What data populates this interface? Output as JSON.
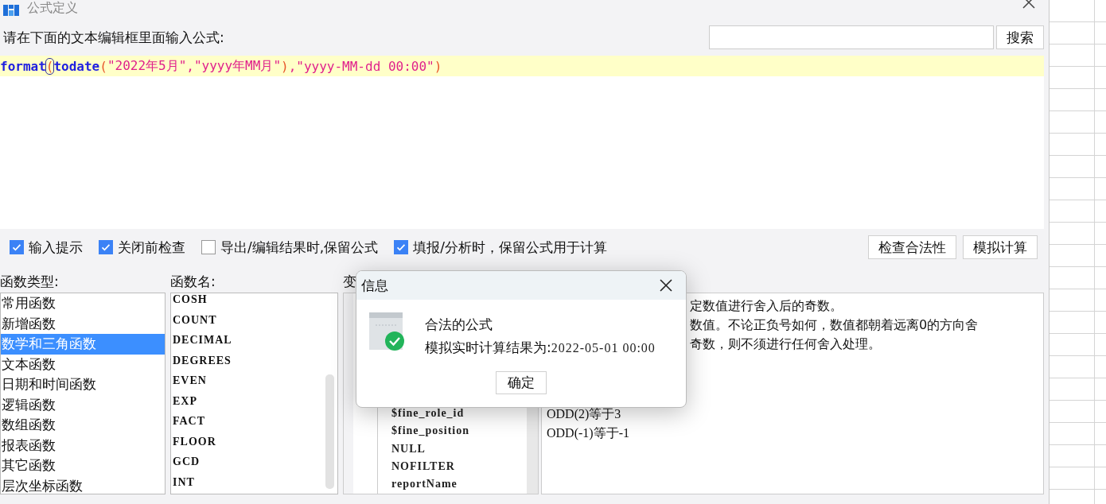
{
  "window": {
    "title": "公式定义"
  },
  "prompt": {
    "label": "请在下面的文本编辑框里面输入公式:",
    "search_button": "搜索"
  },
  "editor": {
    "tokens": [
      {
        "text": "format",
        "kind": "function",
        "boxed": false
      },
      {
        "text": "(",
        "kind": "paren",
        "boxed": true
      },
      {
        "text": "todate",
        "kind": "function",
        "boxed": false
      },
      {
        "text": "(",
        "kind": "paren",
        "boxed": false
      },
      {
        "text": "\"2022年5月\"",
        "kind": "string",
        "boxed": false
      },
      {
        "text": ",",
        "kind": "string",
        "boxed": false
      },
      {
        "text": "\"yyyy年MM月\"",
        "kind": "string",
        "boxed": false
      },
      {
        "text": ")",
        "kind": "paren",
        "boxed": false
      },
      {
        "text": ",",
        "kind": "string",
        "boxed": false
      },
      {
        "text": "\"yyyy-MM-dd 00:00\"",
        "kind": "string",
        "boxed": false
      },
      {
        "text": ")",
        "kind": "paren",
        "boxed": false
      }
    ]
  },
  "options": [
    {
      "label": "输入提示",
      "checked": true
    },
    {
      "label": "关闭前检查",
      "checked": true
    },
    {
      "label": "导出/编辑结果时,保留公式",
      "checked": false
    },
    {
      "label": "填报/分析时，保留公式用于计算",
      "checked": true
    }
  ],
  "action_buttons": [
    "检查合法性",
    "模拟计算"
  ],
  "function_types": {
    "label": "函数类型:",
    "items": [
      {
        "label": "常用函数",
        "selected": false
      },
      {
        "label": "新增函数",
        "selected": false
      },
      {
        "label": "数学和三角函数",
        "selected": true
      },
      {
        "label": "文本函数",
        "selected": false
      },
      {
        "label": "日期和时间函数",
        "selected": false
      },
      {
        "label": "逻辑函数",
        "selected": false
      },
      {
        "label": "数组函数",
        "selected": false
      },
      {
        "label": "报表函数",
        "selected": false
      },
      {
        "label": "其它函数",
        "selected": false
      },
      {
        "label": "层次坐标函数",
        "selected": false
      }
    ]
  },
  "function_names": {
    "label": "函数名:",
    "items": [
      "COSH",
      "COUNT",
      "DECIMAL",
      "DEGREES",
      "EVEN",
      "EXP",
      "FACT",
      "FLOOR",
      "GCD",
      "INT"
    ]
  },
  "variables": {
    "label": "变",
    "items": [
      "$fine_role_id",
      "$fine_position",
      "NULL",
      "NOFILTER",
      "reportName"
    ]
  },
  "description": {
    "lines": [
      {
        "text": "定数值进行舍入后的奇数。",
        "kind": "clipped"
      },
      {
        "text": "数值。不论正负号如何，数值都朝着远离0的方向舍",
        "kind": "clipped"
      },
      {
        "text": "奇数，则不须进行任何舍入处理。",
        "kind": "clipped"
      },
      {
        "text": "ODD(2)等于3",
        "kind": "example"
      },
      {
        "text": "ODD(-1)等于-1",
        "kind": "example"
      }
    ]
  },
  "message_box": {
    "title": "信息",
    "message": "合法的公式",
    "result_label": "模拟实时计算结果为:",
    "result_value": "2022-05-01 00:00",
    "ok_button": "确定"
  }
}
